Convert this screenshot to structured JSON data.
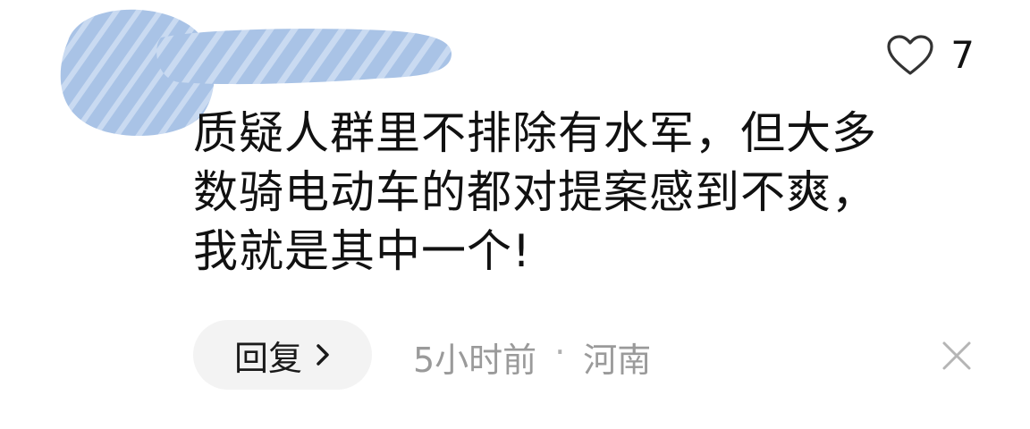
{
  "comment": {
    "like_count": "7",
    "lines": [
      "质疑人群里不排除有水军，但大多",
      "数骑电动车的都对提案感到不爽，",
      "我就是其中一个!"
    ]
  },
  "footer": {
    "reply_label": "回复",
    "time": "5小时前",
    "separator": "·",
    "location": "河南"
  },
  "icons": {
    "like": "heart-outline-icon",
    "reply_arrow": "chevron-right-icon",
    "dismiss": "close-icon"
  }
}
